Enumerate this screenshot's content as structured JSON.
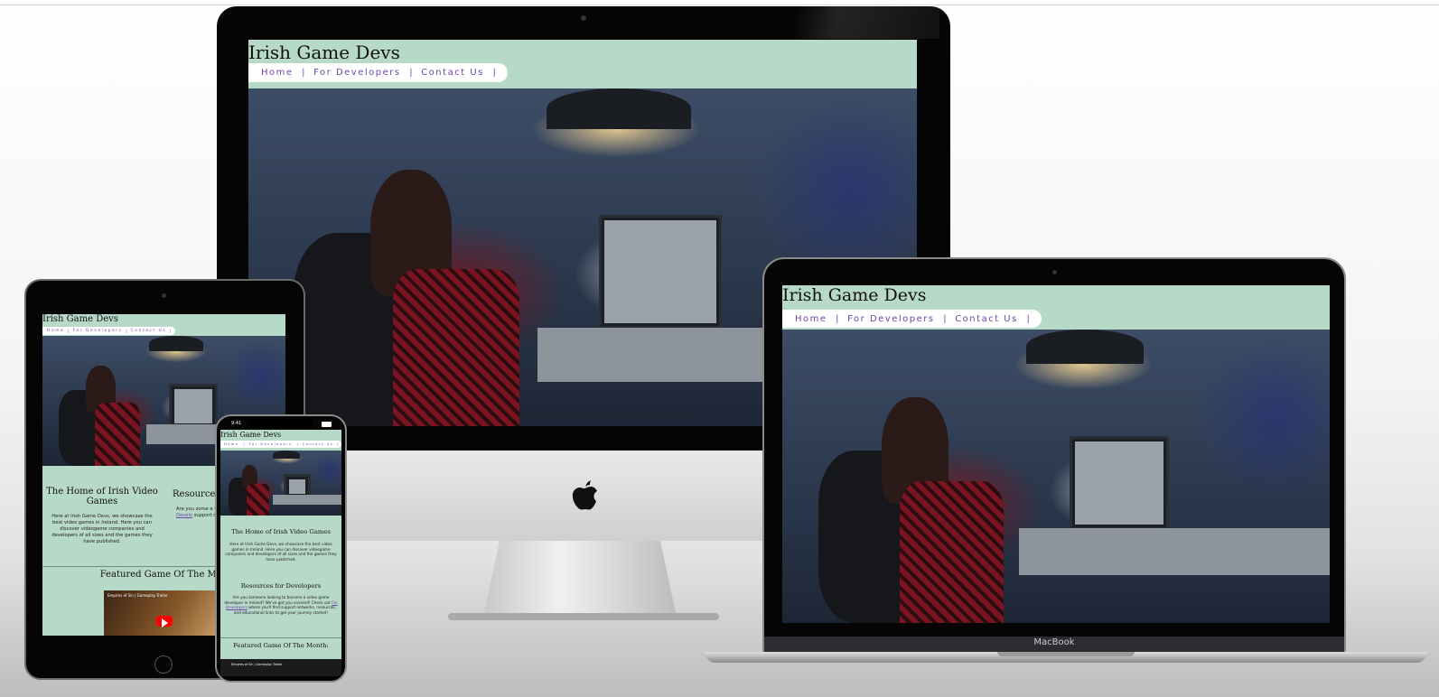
{
  "site": {
    "title": "Irish Game Devs",
    "nav": [
      {
        "label": "Home"
      },
      {
        "label": "For Developers"
      },
      {
        "label": "Contact Us"
      }
    ],
    "home_heading": "The Home of Irish Video Games",
    "home_text": "Here at Irish Game Devs, we showcase the best video games in Ireland. Here you can discover videogame companies and developers of all sizes and the games they have published.",
    "resources_heading": "Resources for Developers",
    "resources_text_before": "Are you someone looking to become a video game developer in Ireland? We've got you covered! Check out ",
    "resources_link": "For Developers",
    "resources_text_after": " where you'll find support networks, resources, and educational links to get your journey started!",
    "featured_heading": "Featured Game Of The Month:",
    "featured_heading_tablet": "Featured Game Of The Mon",
    "resources_heading_tablet": "Resources",
    "resources_text_tablet": "Are you some a video game We've got yo",
    "resources_link_tablet": "For Develo",
    "resources_text_tablet_after": "support net educational li",
    "video_title": "Empires of Sin | Gameplay Trailer"
  },
  "devices": {
    "laptop_brand": "MacBook",
    "phone_time": "9:41"
  },
  "colors": {
    "page_bg": "#b7d9c8",
    "nav_text": "#6e44a8",
    "bezel": "#050505"
  }
}
